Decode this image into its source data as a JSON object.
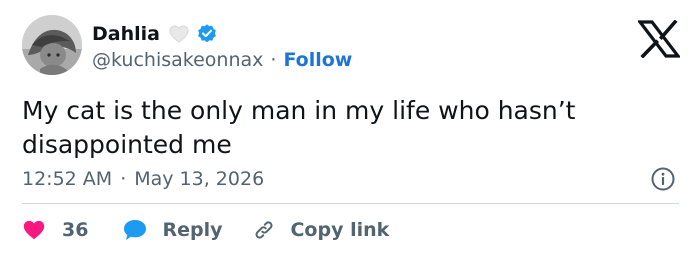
{
  "author": {
    "display_name": "Dahlia",
    "handle": "@kuchisakeonnax",
    "follow_label": "Follow",
    "separator": "·"
  },
  "tweet": {
    "text": "My cat is the only man in my life who hasn’t\ndisappointed me",
    "time": "12:52 AM",
    "date": "May 13, 2026",
    "separator": "·"
  },
  "actions": {
    "like_count": "36",
    "reply_label": "Reply",
    "copy_link_label": "Copy link"
  },
  "icons": {
    "heart": "heart-icon",
    "reply": "speech-bubble-icon",
    "copy_link": "link-icon",
    "info": "info-icon",
    "verified": "verified-badge-icon",
    "logo": "x-logo-icon",
    "name_emoji": "white-heart-emoji"
  },
  "colors": {
    "text": "#0f1419",
    "secondary": "#536471",
    "follow": "#1d76d6",
    "verified": "#1d9bf0",
    "like": "#f91880",
    "reply": "#1d9bf0",
    "divider": "#cfd9de"
  }
}
